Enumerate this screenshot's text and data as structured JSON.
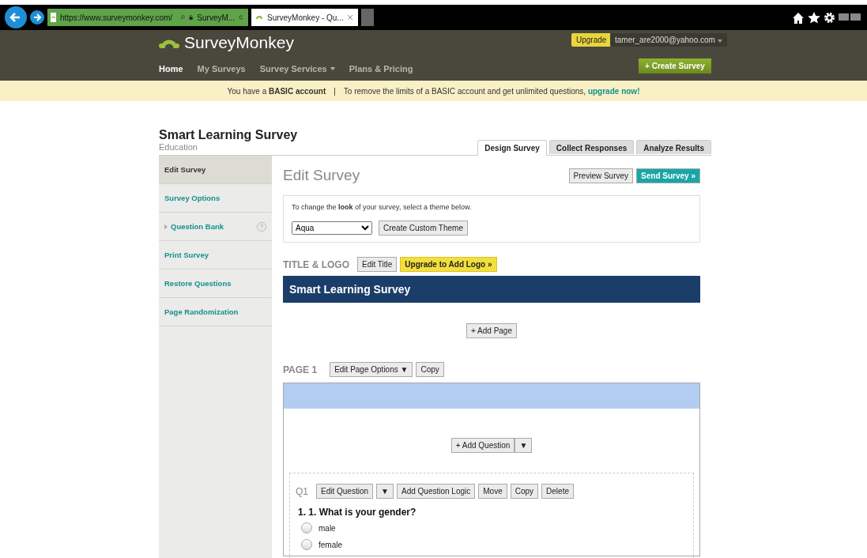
{
  "browser": {
    "address": "https://www.surveymonkey.com/",
    "site_tab": "SurveyM...",
    "tabs": [
      {
        "label": "SurveyMonkey - Qu...",
        "selected": true
      }
    ]
  },
  "header": {
    "logo": "SurveyMonkey",
    "upgrade": "Upgrade",
    "account": "tamer_are2000@yahoo.com",
    "create": "+ Create Survey",
    "nav": [
      {
        "label": "Home",
        "selected": true,
        "dropdown": false
      },
      {
        "label": "My Surveys",
        "selected": false,
        "dropdown": false
      },
      {
        "label": "Survey Services",
        "selected": false,
        "dropdown": true
      },
      {
        "label": "Plans & Pricing",
        "selected": false,
        "dropdown": false
      }
    ]
  },
  "banner": {
    "text": "You have a **BASIC account**",
    "separator": "|",
    "message": "To remove the limits of a BASIC account and get unlimited questions,",
    "link": "upgrade now!"
  },
  "survey": {
    "title": "Smart Learning Survey",
    "category": "Education"
  },
  "tabs": [
    {
      "label": "Design Survey",
      "selected": true
    },
    {
      "label": "Collect Responses",
      "selected": false
    },
    {
      "label": "Analyze Results",
      "selected": false
    }
  ],
  "sidebar": {
    "items": [
      {
        "label": "Edit Survey",
        "selected": true,
        "kind": "link"
      },
      {
        "label": "Survey Options",
        "selected": false,
        "kind": "link"
      },
      {
        "label": "Question Bank",
        "selected": false,
        "kind": "expandable",
        "help": "?"
      },
      {
        "label": "Print Survey",
        "selected": false,
        "kind": "link"
      },
      {
        "label": "Restore Questions",
        "selected": false,
        "kind": "link"
      },
      {
        "label": "Page Randomization",
        "selected": false,
        "kind": "link"
      }
    ]
  },
  "main": {
    "heading": "Edit Survey",
    "preview": "Preview Survey",
    "send": "Send Survey »",
    "theme": {
      "hint": "To change the **look** of your survey, select a theme below.",
      "value": "Aqua",
      "custom": "Create Custom Theme"
    },
    "title_logo": {
      "label": "TITLE & LOGO",
      "edit": "Edit Title",
      "upgrade": "Upgrade to Add Logo »",
      "banner": "Smart Learning Survey"
    },
    "add_page": "+ Add Page",
    "page": {
      "label": "PAGE 1",
      "options": "Edit Page Options ▼",
      "copy": "Copy",
      "add_question": "+ Add Question",
      "add_menu": "▼",
      "question": {
        "number": "Q1",
        "actions": [
          "Edit Question",
          "▼",
          "Add Question Logic",
          "Move",
          "Copy",
          "Delete"
        ],
        "text": "1. 1. What is your gender?",
        "options": [
          {
            "label": "male",
            "selected": false
          },
          {
            "label": "female",
            "selected": false
          }
        ]
      }
    }
  }
}
